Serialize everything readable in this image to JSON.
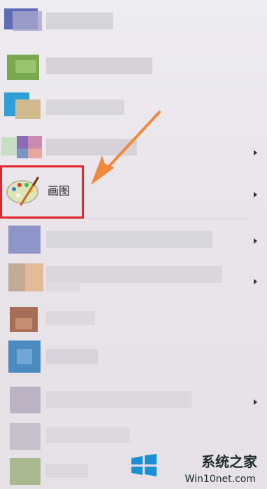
{
  "menu": {
    "highlighted_item": {
      "label": "画图",
      "icon": "paint-palette-icon"
    },
    "submenu_indicator_icon": "chevron-right-icon"
  },
  "annotation": {
    "arrow_color": "#f08a3a",
    "highlight_color": "#e3262b"
  },
  "watermark": {
    "name": "系统之家",
    "url": "Win10net.com"
  }
}
